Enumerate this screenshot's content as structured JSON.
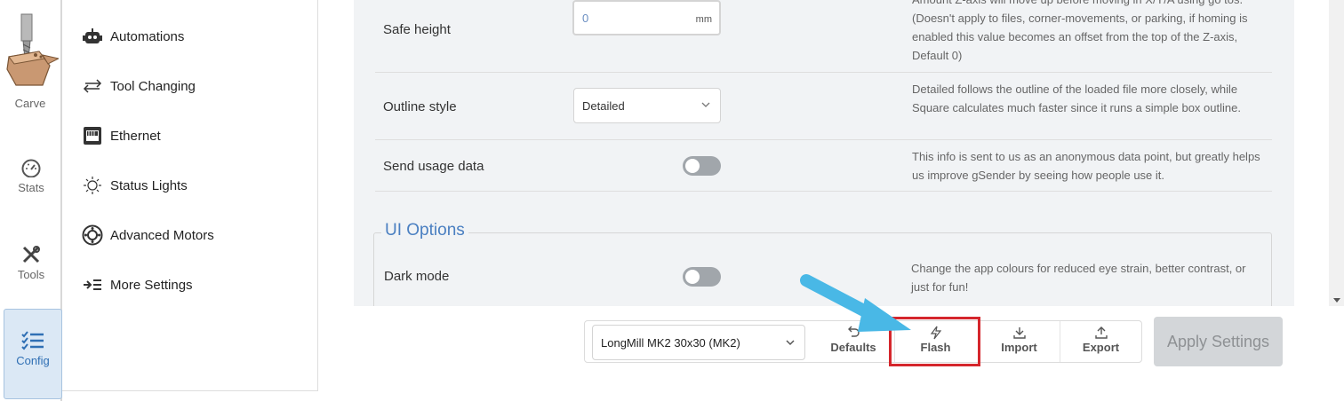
{
  "rail": {
    "items": [
      {
        "label": "Carve"
      },
      {
        "label": "Stats"
      },
      {
        "label": "Tools"
      },
      {
        "label": "Config"
      }
    ]
  },
  "categories": [
    {
      "label": "Automations",
      "icon": "robot-icon"
    },
    {
      "label": "Tool Changing",
      "icon": "swap-arrows-icon"
    },
    {
      "label": "Ethernet",
      "icon": "ethernet-port-icon"
    },
    {
      "label": "Status Lights",
      "icon": "sun-icon"
    },
    {
      "label": "Advanced Motors",
      "icon": "motor-icon"
    },
    {
      "label": "More Settings",
      "icon": "more-settings-icon"
    }
  ],
  "settings": {
    "safe_height": {
      "label": "Safe height",
      "value": "0",
      "unit": "mm",
      "description": "Amount Z-axis will move up before moving in X/Y/A using go tos. (Doesn't apply to files, corner-movements, or parking, if homing is enabled this value becomes an offset from the top of the Z-axis, Default 0)"
    },
    "outline_style": {
      "label": "Outline style",
      "value": "Detailed",
      "description": "Detailed follows the outline of the loaded file more closely, while Square calculates much faster since it runs a simple box outline."
    },
    "send_usage": {
      "label": "Send usage data",
      "enabled": false,
      "description": "This info is sent to us as an anonymous data point, but greatly helps us improve gSender by seeing how people use it."
    },
    "ui_options": {
      "legend": "UI Options",
      "dark_mode": {
        "label": "Dark mode",
        "enabled": false,
        "description": "Change the app colours for reduced eye strain, better contrast, or just for fun!"
      }
    }
  },
  "footer": {
    "machine": "LongMill MK2 30x30 (MK2)",
    "buttons": [
      {
        "label": "Defaults",
        "icon": "undo-icon"
      },
      {
        "label": "Flash",
        "icon": "lightning-icon"
      },
      {
        "label": "Import",
        "icon": "download-icon"
      },
      {
        "label": "Export",
        "icon": "upload-icon"
      }
    ],
    "apply": "Apply Settings"
  },
  "colors": {
    "accent": "#4a7fc1",
    "highlight": "#d5262c",
    "annotation_arrow": "#49b8e6"
  }
}
